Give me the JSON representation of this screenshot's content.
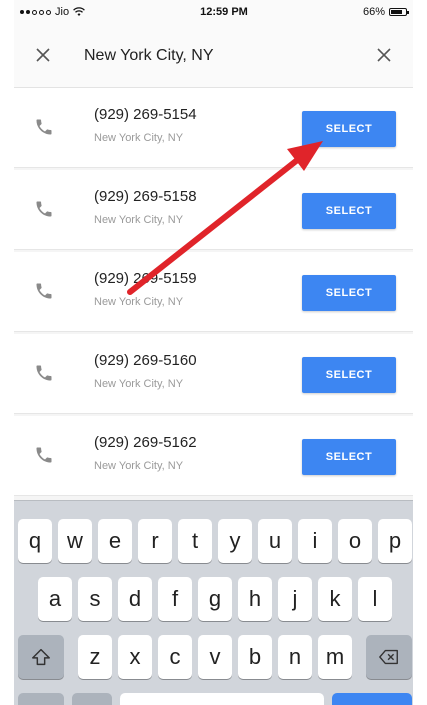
{
  "status_bar": {
    "carrier": "Jio",
    "time": "12:59 PM",
    "battery": "66%"
  },
  "search": {
    "query": "New York City, NY"
  },
  "results": [
    {
      "number": "(929) 269-5154",
      "location": "New York City, NY",
      "button": "SELECT"
    },
    {
      "number": "(929) 269-5158",
      "location": "New York City, NY",
      "button": "SELECT"
    },
    {
      "number": "(929) 269-5159",
      "location": "New York City, NY",
      "button": "SELECT"
    },
    {
      "number": "(929) 269-5160",
      "location": "New York City, NY",
      "button": "SELECT"
    },
    {
      "number": "(929) 269-5162",
      "location": "New York City, NY",
      "button": "SELECT"
    }
  ],
  "keyboard": {
    "row1": [
      "q",
      "w",
      "e",
      "r",
      "t",
      "y",
      "u",
      "i",
      "o",
      "p"
    ],
    "row2": [
      "a",
      "s",
      "d",
      "f",
      "g",
      "h",
      "j",
      "k",
      "l"
    ],
    "row3": [
      "z",
      "x",
      "c",
      "v",
      "b",
      "n",
      "m"
    ]
  },
  "colors": {
    "accent": "#3d86f2",
    "annotation_arrow": "#e0242a"
  },
  "icons": {
    "close_left": "close-icon",
    "close_right": "close-icon",
    "phone": "phone-icon",
    "shift": "shift-icon",
    "backspace": "backspace-icon"
  }
}
